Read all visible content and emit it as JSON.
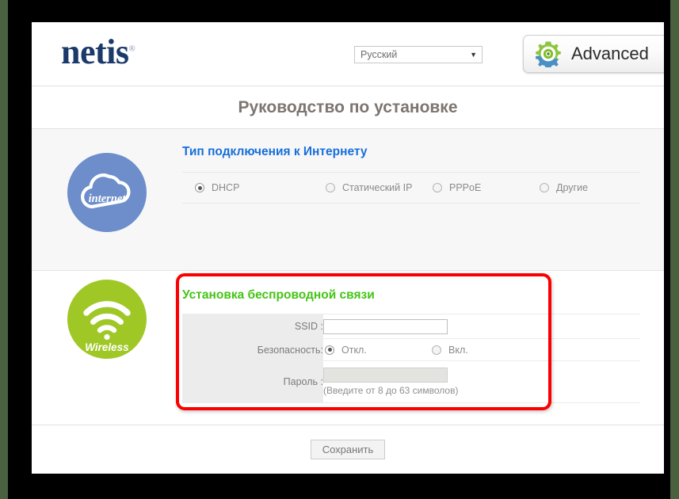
{
  "window": {
    "outer_background": "#000000",
    "desktop_background": "#4a6140"
  },
  "header": {
    "logo_text": "netis",
    "logo_registered_mark": "®",
    "logo_color": "#1b3a6b",
    "language_select": {
      "value": "Русский",
      "arrow_glyph": "▼"
    },
    "advanced_button": {
      "label": "Advanced",
      "icon": "gear-icon",
      "icon_colors": [
        "#8cc63f",
        "#4a90c4"
      ]
    }
  },
  "page_title": "Руководство по установке",
  "page_title_color": "#7d7570",
  "internet_section": {
    "icon": {
      "name": "internet-cloud-icon",
      "caption": "internet",
      "circle_color": "#6d8dcb"
    },
    "heading": "Тип подключения к Интернету",
    "heading_color": "#176fdb",
    "connection_options": [
      {
        "label": "DHCP",
        "selected": true
      },
      {
        "label": "Статический IP",
        "selected": false
      },
      {
        "label": "PPPoE",
        "selected": false
      },
      {
        "label": "Другие",
        "selected": false
      }
    ]
  },
  "wireless_section": {
    "icon": {
      "name": "wireless-wifi-icon",
      "caption": "Wireless",
      "circle_color": "#9fc826"
    },
    "heading": "Установка беспроводной связи",
    "heading_color": "#44c414",
    "highlight_color": "#fb0000",
    "fields": {
      "ssid": {
        "label": "SSID :",
        "value": "",
        "placeholder": "",
        "disabled": false
      },
      "security": {
        "label": "Безопасность:",
        "options": [
          {
            "label": "Откл.",
            "selected": true
          },
          {
            "label": "Вкл.",
            "selected": false
          }
        ]
      },
      "password": {
        "label": "Пароль :",
        "value": "",
        "placeholder": "",
        "disabled": true,
        "hint": "(Введите от 8 до 63 символов)"
      }
    }
  },
  "footer": {
    "save_button_label": "Сохранить"
  }
}
